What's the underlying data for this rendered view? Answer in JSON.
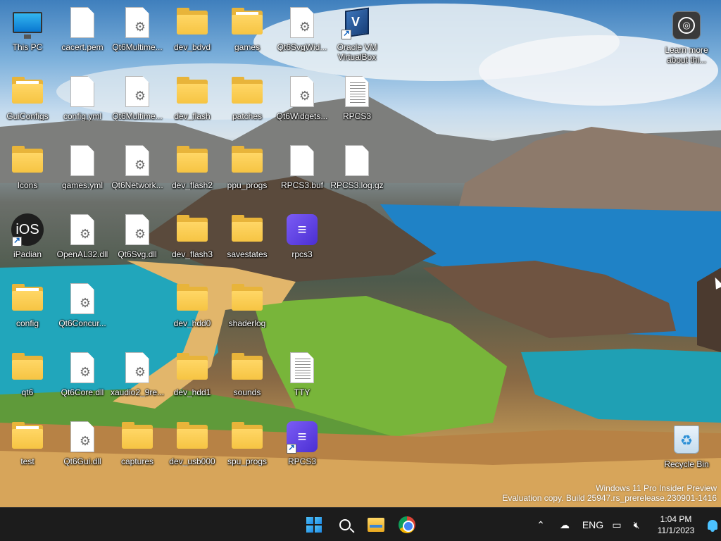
{
  "desktop": {
    "icons": [
      {
        "label": "This PC",
        "type": "monitor",
        "shortcut": false
      },
      {
        "label": "cacert.pem",
        "type": "file",
        "shortcut": false
      },
      {
        "label": "Qt6Multime...",
        "type": "dll",
        "shortcut": false
      },
      {
        "label": "dev_bdvd",
        "type": "folder",
        "shortcut": false
      },
      {
        "label": "games",
        "type": "folder-docs",
        "shortcut": false
      },
      {
        "label": "Qt6SvgWid...",
        "type": "dll",
        "shortcut": false
      },
      {
        "label": "Oracle VM VirtualBox",
        "type": "virtualbox",
        "shortcut": true
      },
      {
        "label": "GuiConfigs",
        "type": "folder-docs",
        "shortcut": false
      },
      {
        "label": "config.yml",
        "type": "file",
        "shortcut": false
      },
      {
        "label": "Qt6Multime...",
        "type": "dll",
        "shortcut": false
      },
      {
        "label": "dev_flash",
        "type": "folder",
        "shortcut": false
      },
      {
        "label": "patches",
        "type": "folder",
        "shortcut": false
      },
      {
        "label": "Qt6Widgets...",
        "type": "dll",
        "shortcut": false
      },
      {
        "label": "RPCS3",
        "type": "text-file",
        "shortcut": false
      },
      {
        "label": "Icons",
        "type": "folder",
        "shortcut": false
      },
      {
        "label": "games.yml",
        "type": "file",
        "shortcut": false
      },
      {
        "label": "Qt6Network...",
        "type": "dll",
        "shortcut": false
      },
      {
        "label": "dev_flash2",
        "type": "folder",
        "shortcut": false
      },
      {
        "label": "ppu_progs",
        "type": "folder",
        "shortcut": false
      },
      {
        "label": "RPCS3.buf",
        "type": "file",
        "shortcut": false
      },
      {
        "label": "RPCS3.log.gz",
        "type": "file",
        "shortcut": false
      },
      {
        "label": "iPadian",
        "type": "ios",
        "shortcut": true
      },
      {
        "label": "OpenAL32.dll",
        "type": "dll",
        "shortcut": false
      },
      {
        "label": "Qt6Svg.dll",
        "type": "dll",
        "shortcut": false
      },
      {
        "label": "dev_flash3",
        "type": "folder",
        "shortcut": false
      },
      {
        "label": "savestates",
        "type": "folder",
        "shortcut": false
      },
      {
        "label": "rpcs3",
        "type": "rpcs3",
        "shortcut": false
      },
      {
        "label": "config",
        "type": "folder-docs",
        "shortcut": false
      },
      {
        "label": "Qt6Concur...",
        "type": "dll",
        "shortcut": false
      },
      {
        "label": "dev_hdd0",
        "type": "folder",
        "shortcut": false
      },
      {
        "label": "shaderlog",
        "type": "folder",
        "shortcut": false
      },
      {
        "label": "qt6",
        "type": "folder",
        "shortcut": false
      },
      {
        "label": "Qt6Core.dll",
        "type": "dll",
        "shortcut": false
      },
      {
        "label": "xaudio2_9re...",
        "type": "dll",
        "shortcut": false
      },
      {
        "label": "dev_hdd1",
        "type": "folder",
        "shortcut": false
      },
      {
        "label": "sounds",
        "type": "folder",
        "shortcut": false
      },
      {
        "label": "TTY",
        "type": "text-file",
        "shortcut": false
      },
      {
        "label": "test",
        "type": "folder-docs",
        "shortcut": false
      },
      {
        "label": "Qt6Gui.dll",
        "type": "dll",
        "shortcut": false
      },
      {
        "label": "captures",
        "type": "folder",
        "shortcut": false
      },
      {
        "label": "dev_usb000",
        "type": "folder",
        "shortcut": false
      },
      {
        "label": "spu_progs",
        "type": "folder",
        "shortcut": false
      },
      {
        "label": "RPCS3",
        "type": "rpcs3",
        "shortcut": true
      }
    ],
    "learn_more_label": "Learn more about thi...",
    "recycle_bin_label": "Recycle Bin",
    "watermark": {
      "line1": "Windows 11 Pro Insider Preview",
      "line2": "Evaluation copy. Build 25947.rs_prerelease.230901-1416"
    }
  },
  "taskbar": {
    "apps": [
      {
        "name": "Start",
        "icon": "windows-icon"
      },
      {
        "name": "Search",
        "icon": "search-icon"
      },
      {
        "name": "File Explorer",
        "icon": "folder-icon"
      },
      {
        "name": "Google Chrome",
        "icon": "chrome-icon"
      }
    ],
    "tray": {
      "language": "ENG",
      "time": "1:04 PM",
      "date": "11/1/2023"
    }
  },
  "colors": {
    "taskbar_bg": "#1c1c1c",
    "accent": "#4cc2ff",
    "folder": "#f6c443"
  }
}
